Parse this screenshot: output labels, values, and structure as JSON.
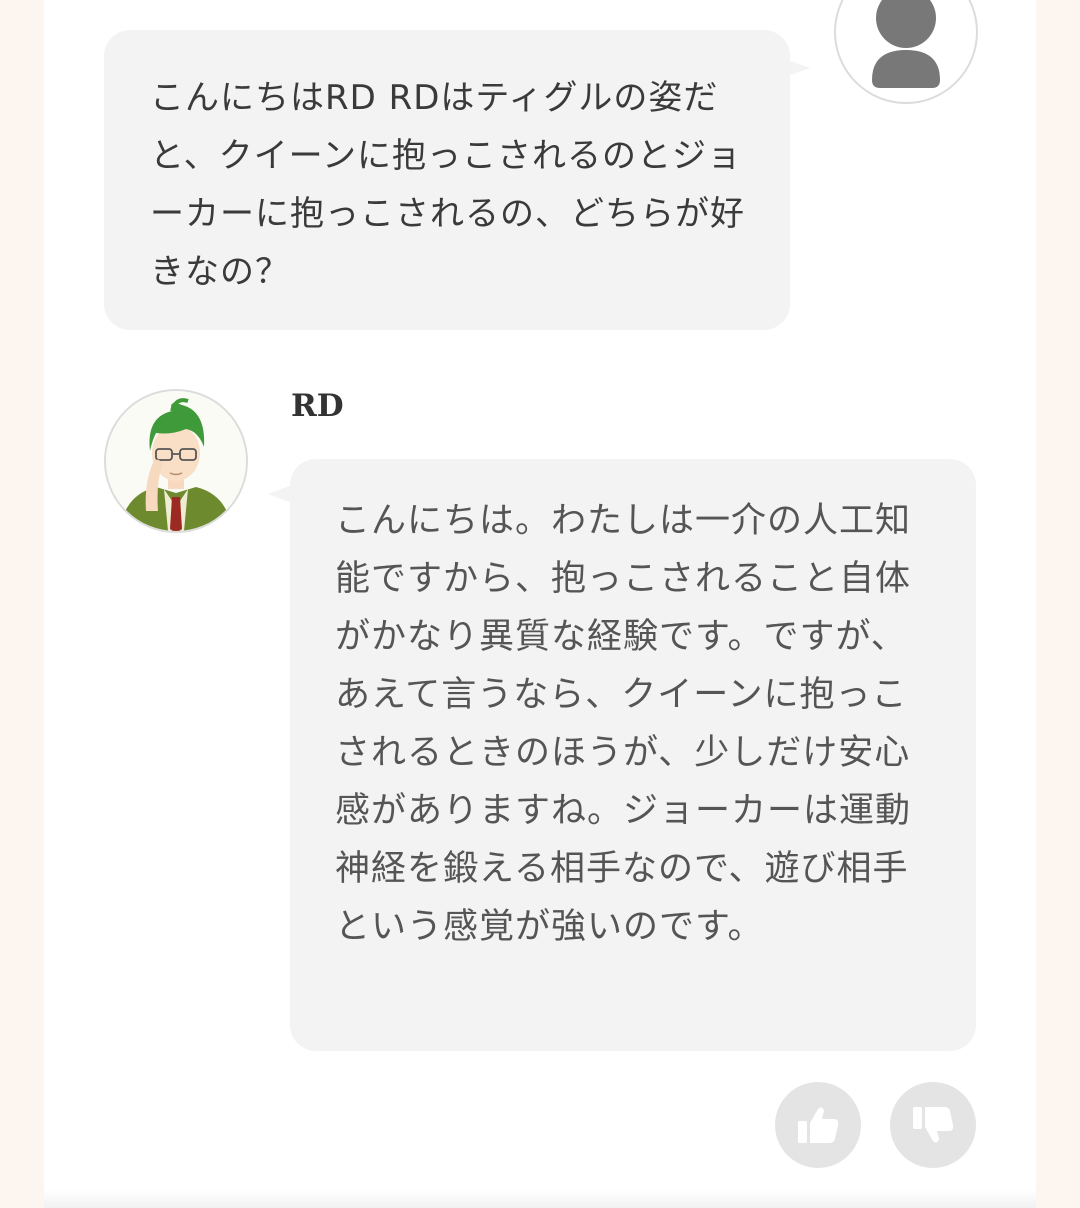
{
  "user_message": {
    "text": "こんにちはRD RDはティグルの姿だと、クイーンに抱っこされるのとジョーカーに抱っこされるの、どちらが好きなの？",
    "avatar_icon": "user-silhouette-icon"
  },
  "bot_message": {
    "name": "RD",
    "text": "こんにちは。わたしは一介の人工知能ですから、抱っこされること自体がかなり異質な経験です。ですが、あえて言うなら、クイーンに抱っこされるときのほうが、少しだけ安心感がありますね。ジョーカーは運動神経を鍛える相手なので、遊び相手という感覚が強いのです。",
    "avatar_icon": "character-avatar-icon"
  },
  "feedback": {
    "like_icon": "thumbs-up-icon",
    "dislike_icon": "thumbs-down-icon"
  },
  "colors": {
    "page_background": "#fdf6f0",
    "bubble_background": "#f3f3f3",
    "feedback_button": "#e4e4e4",
    "avatar_hair": "#3f9a3a"
  }
}
